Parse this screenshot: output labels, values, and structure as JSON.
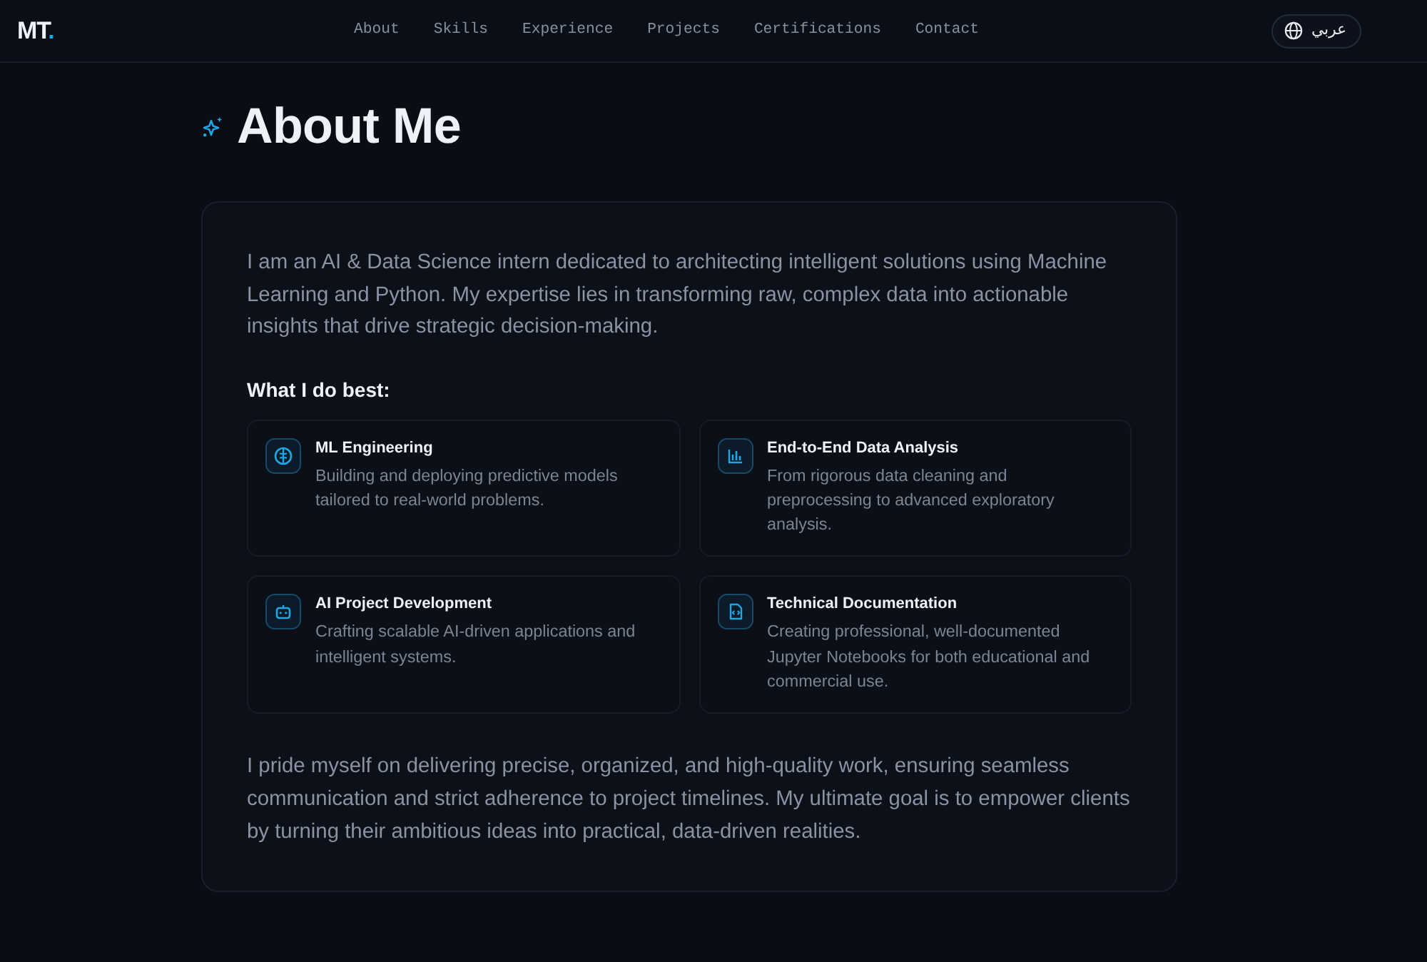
{
  "navbar": {
    "logo": {
      "text": "MT",
      "accent": "."
    },
    "links": [
      "About",
      "Skills",
      "Experience",
      "Projects",
      "Certifications",
      "Contact"
    ],
    "language_button": {
      "label": "عربي"
    }
  },
  "about": {
    "title": "About Me",
    "intro": "I am an AI & Data Science intern dedicated to architecting intelligent solutions using Machine Learning and Python. My expertise lies in transforming raw, complex data into actionable insights that drive strategic decision-making.",
    "subheading": "What I do best:",
    "features": [
      {
        "title": "ML Engineering",
        "description": "Building and deploying predictive models tailored to real-world problems."
      },
      {
        "title": "End-to-End Data Analysis",
        "description": "From rigorous data cleaning and preprocessing to advanced exploratory analysis."
      },
      {
        "title": "AI Project Development",
        "description": "Crafting scalable AI-driven applications and intelligent systems."
      },
      {
        "title": "Technical Documentation",
        "description": "Creating professional, well-documented Jupyter Notebooks for both educational and commercial use."
      }
    ],
    "closing": "I pride myself on delivering precise, organized, and high-quality work, ensuring seamless communication and strict adherence to project timelines. My ultimate goal is to empower clients by turning their ambitious ideas into practical, data-driven realities."
  }
}
